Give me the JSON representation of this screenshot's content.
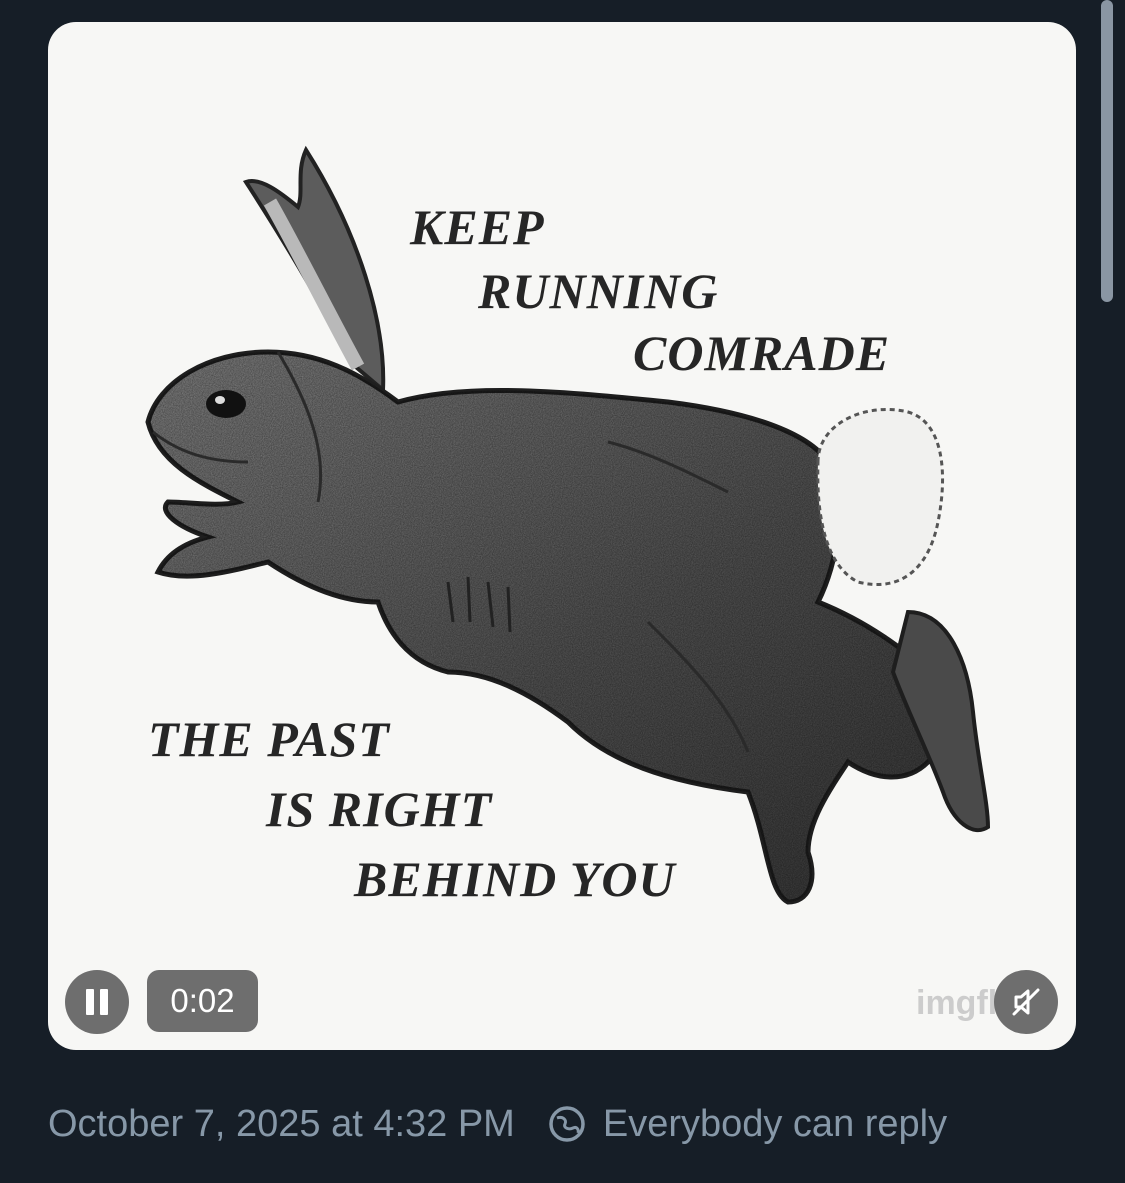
{
  "media": {
    "caption_lines_top": [
      "KEEP",
      "RUNNING",
      "COMRADE"
    ],
    "caption_lines_bottom": [
      "THE PAST",
      "IS RIGHT",
      "BEHIND YOU"
    ],
    "watermark": "imgflip",
    "elapsed_time": "0:02",
    "pause_icon": "pause-icon",
    "mute_icon": "volume-muted-icon"
  },
  "post": {
    "timestamp": "October 7, 2025 at 4:32 PM",
    "reply_setting": "Everybody can reply",
    "reply_icon": "reply-audience-icon"
  },
  "colors": {
    "background": "#161e27",
    "meta_text": "#8798a8",
    "media_bg": "#f7f7f5"
  }
}
